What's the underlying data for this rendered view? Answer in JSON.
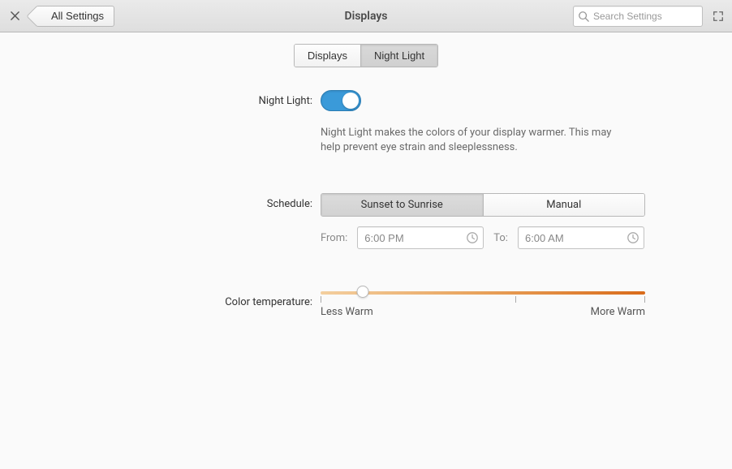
{
  "header": {
    "title": "Displays",
    "back_label": "All Settings",
    "search_placeholder": "Search Settings"
  },
  "tabs": {
    "displays": "Displays",
    "night_light": "Night Light",
    "active": "night_light"
  },
  "night_light": {
    "label": "Night Light:",
    "enabled": true,
    "description": "Night Light makes the colors of your display warmer. This may help prevent eye strain and sleeplessness."
  },
  "schedule": {
    "label": "Schedule:",
    "option_sunset": "Sunset to Sunrise",
    "option_manual": "Manual",
    "active": "sunset",
    "from_label": "From:",
    "to_label": "To:",
    "from_value": "6:00 PM",
    "to_value": "6:00 AM"
  },
  "color_temp": {
    "label": "Color temperature:",
    "min_label": "Less Warm",
    "max_label": "More Warm",
    "value_percent": 13
  }
}
